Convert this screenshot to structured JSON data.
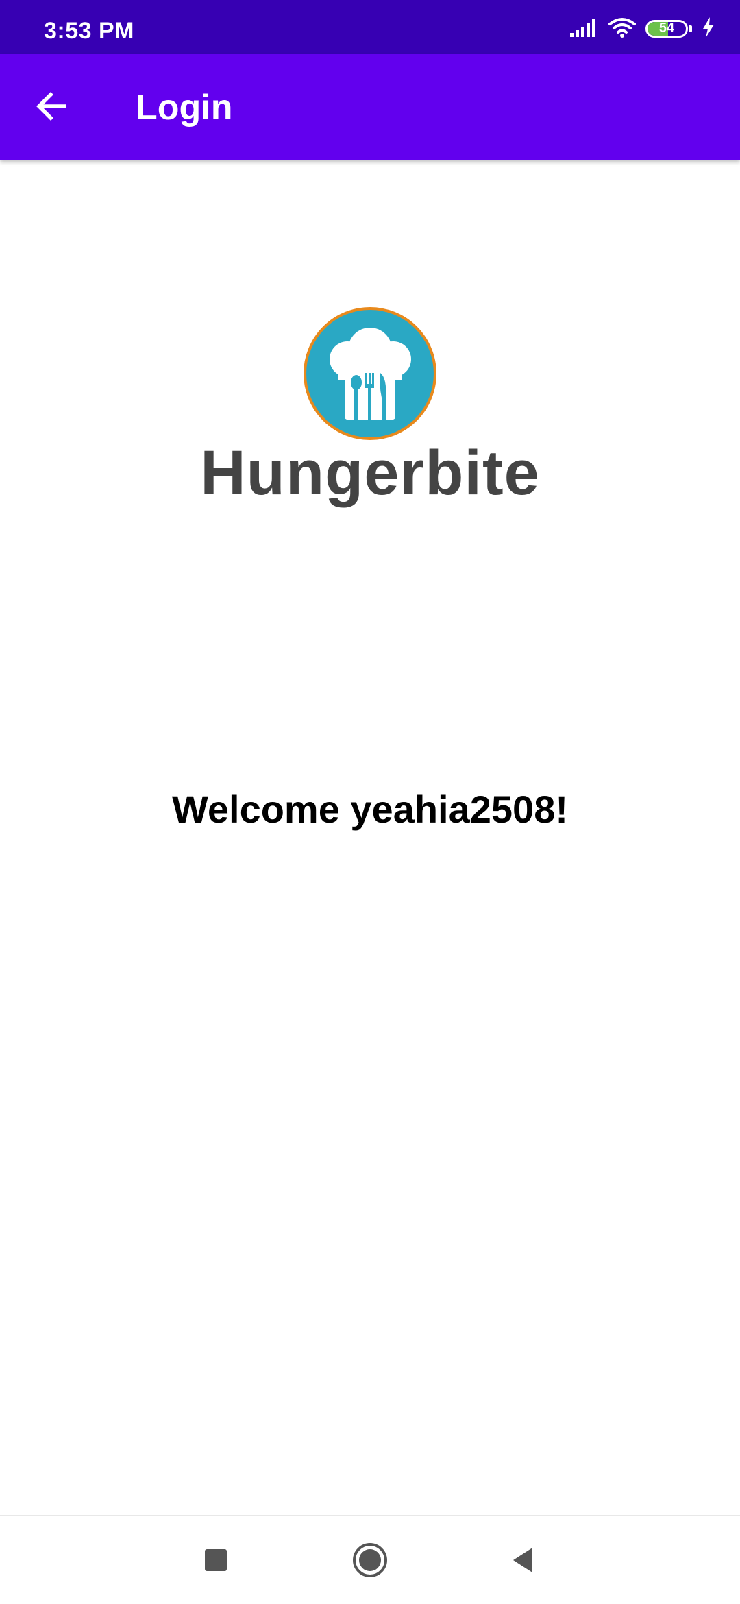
{
  "status_bar": {
    "time": "3:53 PM",
    "battery_level": "54",
    "battery_fraction": 0.54,
    "icons": [
      "signal-icon",
      "wifi-icon",
      "battery-icon",
      "charging-icon"
    ]
  },
  "app_bar": {
    "title": "Login",
    "back_icon": "arrow-left-icon"
  },
  "logo": {
    "wordmark": "Hungerbite",
    "icon": "chef-hat-cutlery-icon"
  },
  "main": {
    "welcome_text": "Welcome yeahia2508!"
  },
  "nav_bar": {
    "icons": [
      "recents-square-icon",
      "home-circle-icon",
      "back-triangle-icon"
    ]
  },
  "colors": {
    "status_bar": "#3700b3",
    "app_bar": "#6200ee",
    "logo_circle": "#2aa8c4",
    "logo_ring": "#e8891c",
    "battery_fill": "#6cc24a"
  }
}
